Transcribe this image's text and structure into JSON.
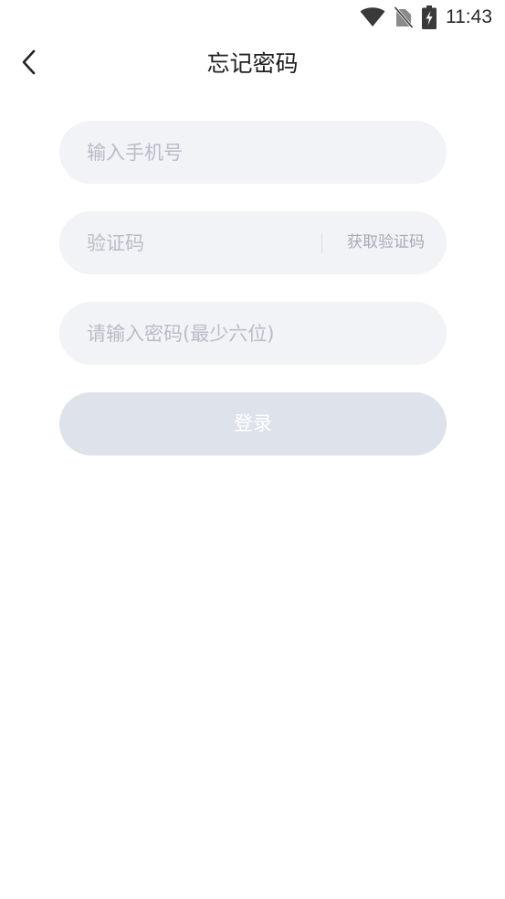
{
  "status_bar": {
    "time": "11:43",
    "icons": [
      "wifi-icon",
      "no-sim-icon",
      "battery-charging-icon"
    ]
  },
  "header": {
    "back_icon": "chevron-left-icon",
    "title": "忘记密码"
  },
  "form": {
    "phone_placeholder": "输入手机号",
    "code_placeholder": "验证码",
    "get_code_label": "获取验证码",
    "password_placeholder": "请输入密码(最少六位)",
    "login_label": "登录"
  },
  "colors": {
    "field_background": "#f2f3f7",
    "placeholder": "#b9bcc6",
    "button_disabled": "#dee2eb",
    "title": "#1f1f1f"
  }
}
